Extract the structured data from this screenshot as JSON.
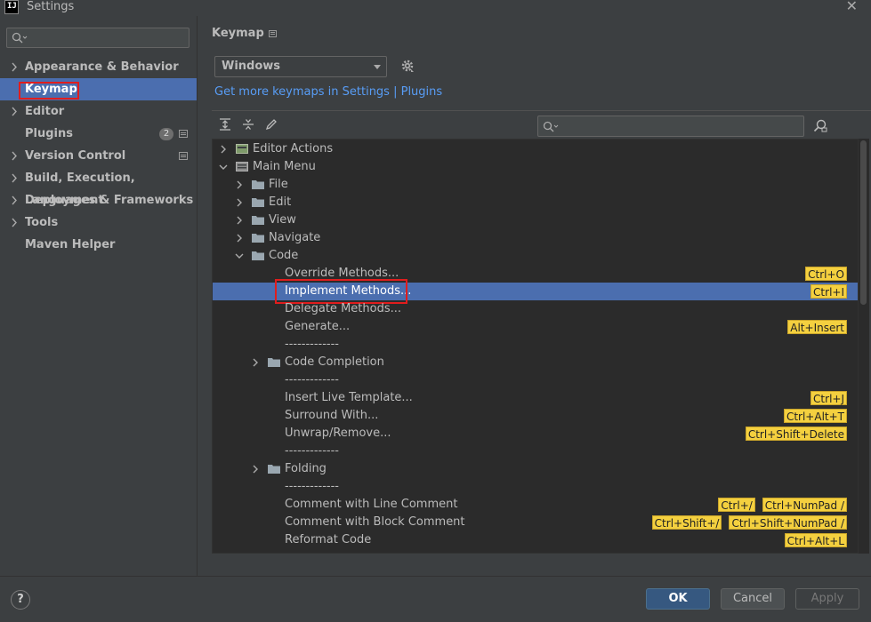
{
  "window": {
    "title": "Settings",
    "app_icon_text": "IJ"
  },
  "sidebar": {
    "search_placeholder": "",
    "items": [
      {
        "label": "Appearance & Behavior",
        "expandable": true
      },
      {
        "label": "Keymap",
        "expandable": false,
        "selected": true
      },
      {
        "label": "Editor",
        "expandable": true
      },
      {
        "label": "Plugins",
        "expandable": false,
        "badge": "2"
      },
      {
        "label": "Version Control",
        "expandable": true
      },
      {
        "label": "Build, Execution, Deployment",
        "expandable": true
      },
      {
        "label": "Languages & Frameworks",
        "expandable": true
      },
      {
        "label": "Tools",
        "expandable": true
      },
      {
        "label": "Maven Helper",
        "expandable": false
      }
    ]
  },
  "main": {
    "title": "Keymap",
    "keymap_select": "Windows",
    "link": "Get more keymaps in Settings | Plugins",
    "tree_search_placeholder": ""
  },
  "tree": [
    {
      "label": "Editor Actions",
      "shortcuts": []
    },
    {
      "label": "Main Menu",
      "shortcuts": []
    },
    {
      "label": "File",
      "shortcuts": []
    },
    {
      "label": "Edit",
      "shortcuts": []
    },
    {
      "label": "View",
      "shortcuts": []
    },
    {
      "label": "Navigate",
      "shortcuts": []
    },
    {
      "label": "Code",
      "shortcuts": []
    },
    {
      "label": "Override Methods...",
      "shortcuts": [
        "Ctrl+O"
      ]
    },
    {
      "label": "Implement Methods...",
      "shortcuts": [
        "Ctrl+I"
      ],
      "selected": true
    },
    {
      "label": "Delegate Methods...",
      "shortcuts": []
    },
    {
      "label": "Generate...",
      "shortcuts": [
        "Alt+Insert"
      ]
    },
    {
      "label": "-------------",
      "shortcuts": []
    },
    {
      "label": "Code Completion",
      "shortcuts": []
    },
    {
      "label": "-------------",
      "shortcuts": []
    },
    {
      "label": "Insert Live Template...",
      "shortcuts": [
        "Ctrl+J"
      ]
    },
    {
      "label": "Surround With...",
      "shortcuts": [
        "Ctrl+Alt+T"
      ]
    },
    {
      "label": "Unwrap/Remove...",
      "shortcuts": [
        "Ctrl+Shift+Delete"
      ]
    },
    {
      "label": "-------------",
      "shortcuts": []
    },
    {
      "label": "Folding",
      "shortcuts": []
    },
    {
      "label": "-------------",
      "shortcuts": []
    },
    {
      "label": "Comment with Line Comment",
      "shortcuts": [
        "Ctrl+/",
        "Ctrl+NumPad /"
      ]
    },
    {
      "label": "Comment with Block Comment",
      "shortcuts": [
        "Ctrl+Shift+/",
        "Ctrl+Shift+NumPad /"
      ]
    },
    {
      "label": "Reformat Code",
      "shortcuts": [
        "Ctrl+Alt+L"
      ]
    }
  ],
  "footer": {
    "help": "?",
    "ok": "OK",
    "cancel": "Cancel",
    "apply": "Apply"
  },
  "colors": {
    "selection": "#4b6eaf",
    "shortcut_bg": "#f4d03f",
    "link": "#589df6",
    "highlight_box": "#e01d1d"
  }
}
